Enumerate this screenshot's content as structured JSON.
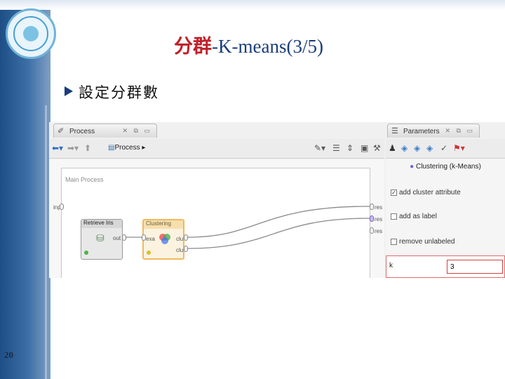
{
  "slide": {
    "title_zh": "分群",
    "title_en": "-K-means(3/5)",
    "bullet": "設定分群數",
    "page_number": "20"
  },
  "app": {
    "process_tab": {
      "label": "Process",
      "icon": "process-icon"
    },
    "parameters_tab": {
      "label": "Parameters",
      "icon": "parameters-icon"
    },
    "breadcrumb": "Process",
    "canvas_title": "Main Process",
    "main_input_port": "inp",
    "output_ports": [
      "res",
      "res",
      "res"
    ],
    "operators": {
      "retrieve": {
        "title": "Retrieve Iris",
        "out_port": "out"
      },
      "clustering": {
        "title": "Clustering",
        "in_port": "exa",
        "out_ports": [
          "clu",
          "clu"
        ]
      }
    },
    "params": {
      "operator_name": "Clustering (k-Means)",
      "options": [
        {
          "label": "add cluster attribute",
          "checked": true
        },
        {
          "label": "add as label",
          "checked": false
        },
        {
          "label": "remove unlabeled",
          "checked": false
        }
      ],
      "k_label": "k",
      "k_value": "3"
    }
  },
  "colors": {
    "title_red": "#c0202a",
    "title_blue": "#1a3d7a",
    "cluster_border": "#f0b860",
    "k_highlight": "#d34040"
  }
}
